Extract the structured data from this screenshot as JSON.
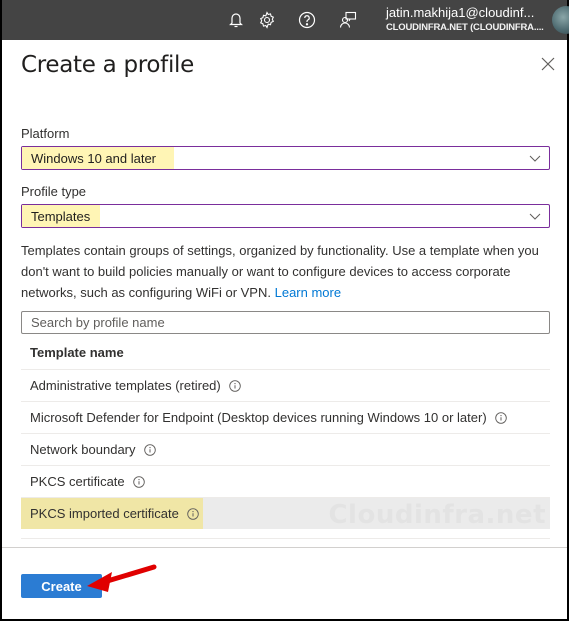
{
  "topbar": {
    "icons": [
      "bell-icon",
      "gear-icon",
      "help-icon",
      "feedback-icon"
    ],
    "account": {
      "email": "jatin.makhija1@cloudinf...",
      "tenant": "CLOUDINFRA.NET (CLOUDINFRA...."
    }
  },
  "panel": {
    "title": "Create a profile",
    "platform": {
      "label": "Platform",
      "value": "Windows 10 and later"
    },
    "profile_type": {
      "label": "Profile type",
      "value": "Templates"
    },
    "description": "Templates contain groups of settings, organized by functionality. Use a template when you don't want to build policies manually or want to configure devices to access corporate networks, such as configuring WiFi or VPN.",
    "learn_more": "Learn more",
    "search": {
      "placeholder": "Search by profile name",
      "value": ""
    },
    "table": {
      "header": "Template name",
      "rows": [
        {
          "name": "Administrative templates (retired)",
          "selected": false
        },
        {
          "name": "Microsoft Defender for Endpoint (Desktop devices running Windows 10 or later)",
          "selected": false
        },
        {
          "name": "Network boundary",
          "selected": false
        },
        {
          "name": "PKCS certificate",
          "selected": false
        },
        {
          "name": "PKCS imported certificate",
          "selected": true
        }
      ]
    },
    "watermark": "Cloudinfra.net",
    "create_label": "Create"
  },
  "colors": {
    "topbar": "#444444",
    "accent": "#2b7cd3",
    "select_border": "#7a2e9c",
    "highlight": "#fff5b5",
    "link": "#0078d4",
    "annotation_arrow": "#e00000"
  }
}
